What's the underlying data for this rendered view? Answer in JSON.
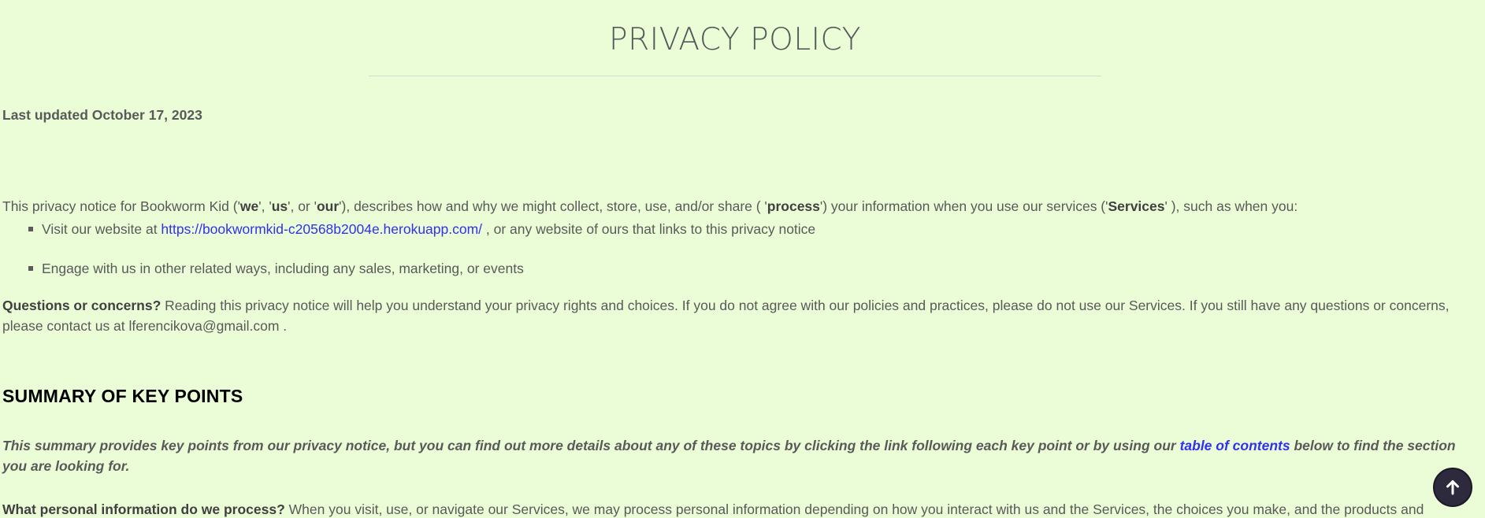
{
  "page": {
    "title": "PRIVACY POLICY",
    "last_updated": "Last updated October 17, 2023"
  },
  "intro": {
    "t1": "This privacy notice for Bookworm Kid ('",
    "we": "we",
    "t2": "', '",
    "us": "us",
    "t3": "', or '",
    "our": "our",
    "t4": "'), describes how and why we might collect, store, use, and/or share ( '",
    "process": "process",
    "t5": "') your information when you use our services ('",
    "services": "Services",
    "t6": "' ), such as when you:"
  },
  "bullets": {
    "b1_prefix": "Visit our website at ",
    "b1_link": "https://bookwormkid-c20568b2004e.herokuapp.com/",
    "b1_suffix": " , or any website of ours that links to this privacy notice",
    "b2": "Engage with us in other related ways, including any sales, marketing, or events"
  },
  "questions": {
    "label": "Questions or concerns?",
    "text": " Reading this privacy notice will help you understand your privacy rights and choices. If you do not agree with our policies and practices, please do not use our Services. If you still have any questions or concerns, please contact us at lferencikova@gmail.com ."
  },
  "summary": {
    "heading": "SUMMARY OF KEY POINTS",
    "intro_before": "This summary provides key points from our privacy notice, but you can find out more details about any of these topics by clicking the link following each key point or by using our ",
    "intro_link": "table of contents",
    "intro_after": " below to find the section you are looking for.",
    "personal_label": "What personal information do we process?",
    "personal_text": " When you visit, use, or navigate our Services, we may process personal information depending on how you interact with us and the Services, the choices you make, and the products and"
  },
  "ui": {
    "back_to_top_icon": "arrow-up-icon"
  }
}
